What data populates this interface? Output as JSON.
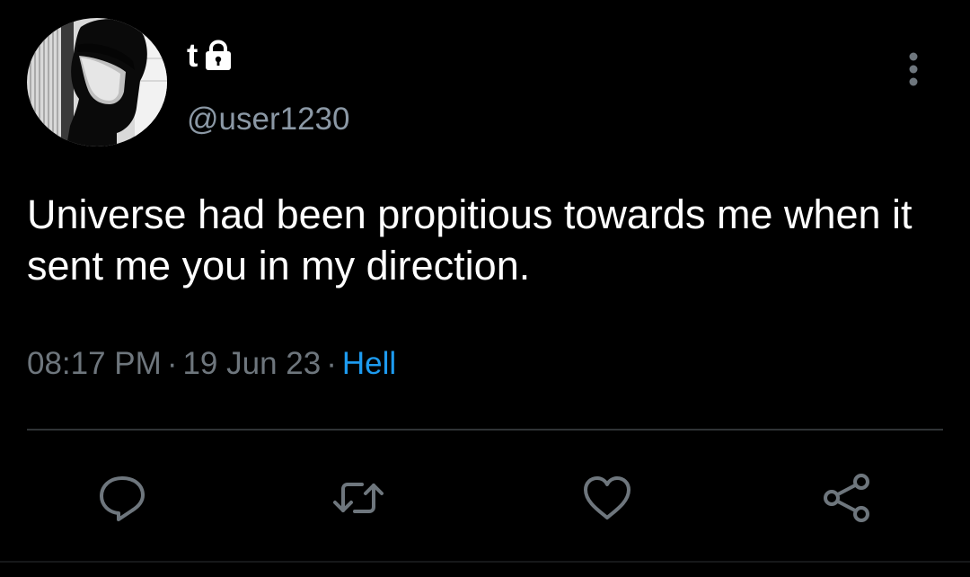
{
  "author": {
    "display_name": "t",
    "handle": "@user1230"
  },
  "tweet": {
    "text": "Universe had been propitious towards me when it sent me you in my direction.",
    "time": "08:17 PM",
    "date": "19 Jun 23",
    "source": "Hell",
    "separator": "·"
  },
  "icons": {
    "lock": "lock-icon",
    "more": "more-vertical-icon",
    "reply": "reply-icon",
    "retweet": "retweet-icon",
    "like": "heart-icon",
    "share": "share-icon"
  },
  "colors": {
    "background": "#000000",
    "text": "#ffffff",
    "muted": "#6e767d",
    "handle": "#8b98a5",
    "link": "#1d9bf0",
    "icon": "#6e767d",
    "divider": "#2f3336"
  }
}
